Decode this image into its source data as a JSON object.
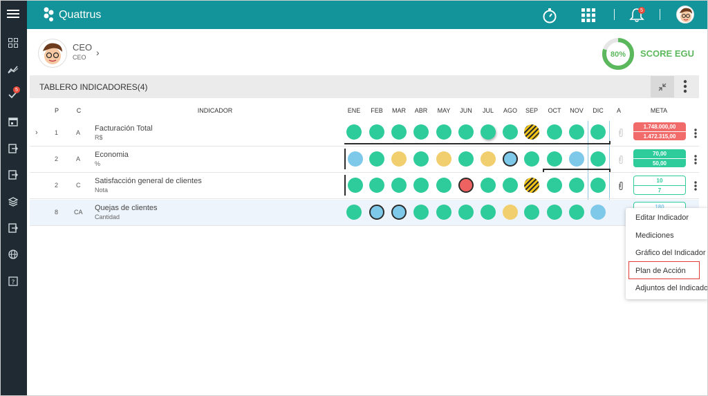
{
  "brand": "Quattrus",
  "notifications_count": "5",
  "sidebar_badge": "5",
  "profile": {
    "name": "CEO",
    "role": "CEO"
  },
  "score": {
    "percent": "80%",
    "value": 0.8,
    "label": "SCORE EGU"
  },
  "panel": {
    "title": "TABLERO INDICADORES(4)"
  },
  "headers": {
    "p": "P",
    "c": "C",
    "indicador": "INDICADOR",
    "months": [
      "ENE",
      "FEB",
      "MAR",
      "ABR",
      "MAY",
      "JUN",
      "JUL",
      "AGO",
      "SEP",
      "OCT",
      "NOV",
      "DIC"
    ],
    "a": "A",
    "meta": "META"
  },
  "rows": [
    {
      "p": "1",
      "c": "A",
      "name": "Facturación Total",
      "unit": "R$",
      "meta_top": "1.748.000,00",
      "meta_bottom": "1.472.315,00"
    },
    {
      "p": "2",
      "c": "A",
      "name": "Economia",
      "unit": "%",
      "meta_top": "70,00",
      "meta_bottom": "50,00"
    },
    {
      "p": "2",
      "c": "C",
      "name": "Satisfacción general de clientes",
      "unit": "Nota",
      "meta_top": "10",
      "meta_bottom": "7"
    },
    {
      "p": "8",
      "c": "CA",
      "name": "Quejas de clientes",
      "unit": "Cantidad",
      "meta_top": "180",
      "meta_bottom": ""
    }
  ],
  "status_colors": {
    "green": "#2ecc9a",
    "blue": "#7ec8ea",
    "yellow": "#f2cf6e",
    "red": "#ef6262",
    "teal": "#13939a",
    "alert_red": "#e53935"
  },
  "menu": {
    "items": [
      "Editar Indicador",
      "Mediciones",
      "Gráfico del Indicador",
      "Plan de Acción",
      "Adjuntos del Indicador"
    ]
  }
}
